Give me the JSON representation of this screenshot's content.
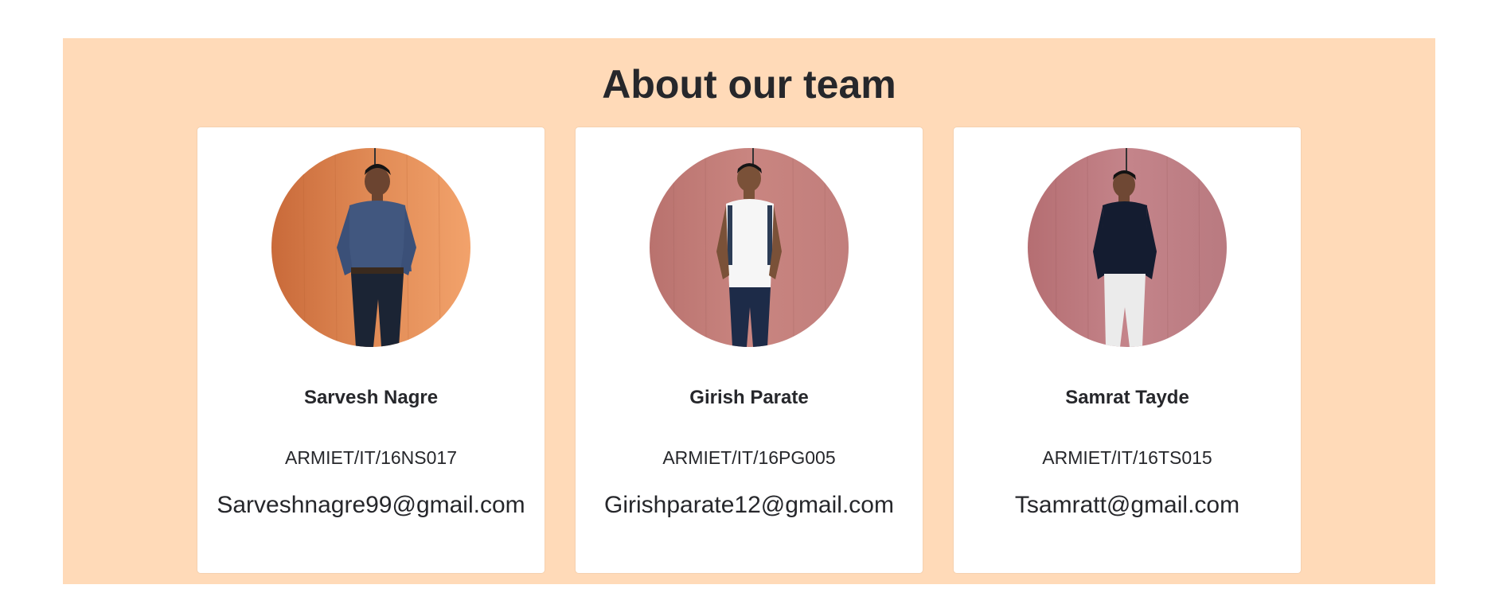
{
  "section": {
    "title": "About our team",
    "background_color": "#ffdab8"
  },
  "members": [
    {
      "name": "Sarvesh Nagre",
      "id": "ARMIET/IT/16NS017",
      "email": "Sarveshnagre99@gmail.com",
      "photo": "portrait-photo-orange-wall-blue-shirt"
    },
    {
      "name": "Girish Parate",
      "id": "ARMIET/IT/16PG005",
      "email": "Girishparate12@gmail.com",
      "photo": "portrait-photo-pink-wall-white-tshirt"
    },
    {
      "name": "Samrat Tayde",
      "id": "ARMIET/IT/16TS015",
      "email": "Tsamratt@gmail.com",
      "photo": "portrait-photo-pink-wall-navy-shirt"
    }
  ]
}
